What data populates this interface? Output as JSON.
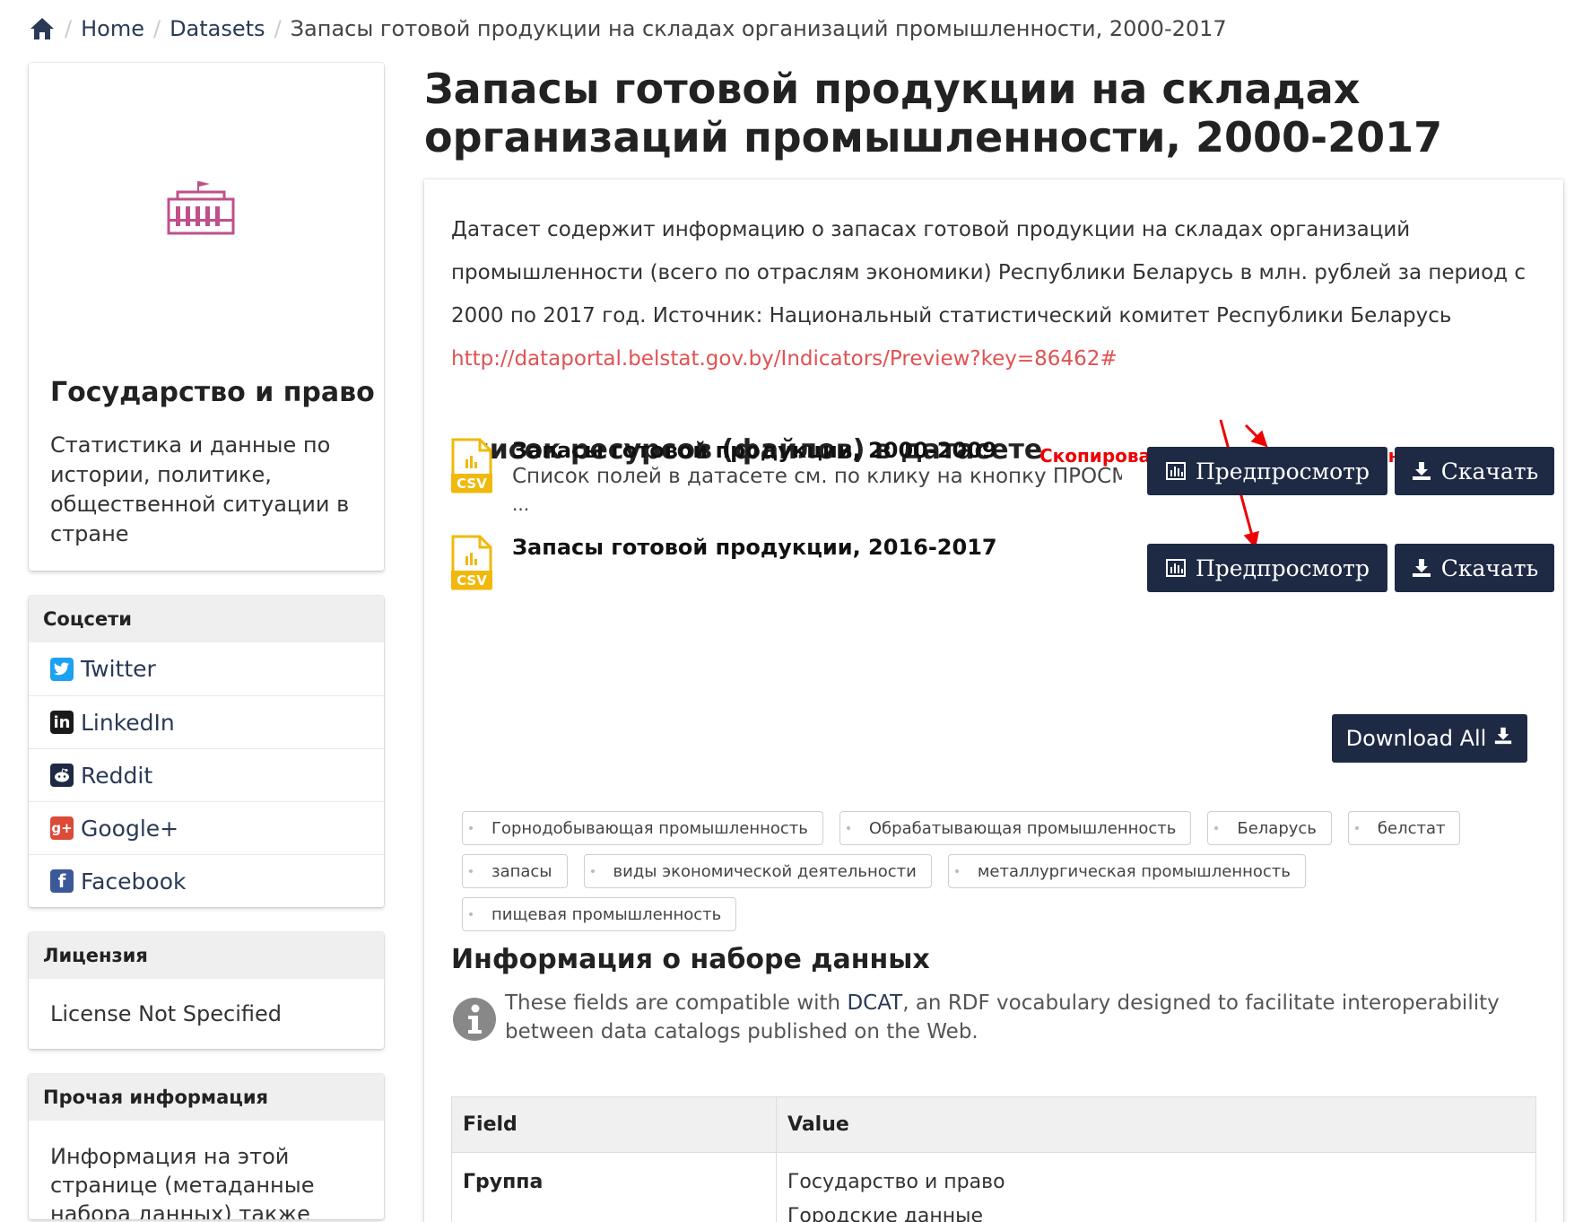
{
  "breadcrumb": {
    "home_icon": "home-icon",
    "items": [
      "Home",
      "Datasets",
      "Запасы готовой продукции на складах организаций промышленности, 2000-2017"
    ]
  },
  "organization": {
    "logo_icon": "government-building-icon",
    "title": "Государство и право",
    "description": "Статистика и данные по истории, политике, общественной ситуации в стране"
  },
  "social": {
    "heading": "Соцсети",
    "items": [
      {
        "label": "Twitter",
        "icon": "twitter-icon"
      },
      {
        "label": "LinkedIn",
        "icon": "linkedin-icon"
      },
      {
        "label": "Reddit",
        "icon": "reddit-icon"
      },
      {
        "label": "Google+",
        "icon": "google-plus-icon"
      },
      {
        "label": "Facebook",
        "icon": "facebook-icon"
      }
    ]
  },
  "license": {
    "heading": "Лицензия",
    "value": "License Not Specified"
  },
  "other_info": {
    "heading": "Прочая информация",
    "text": "Информация на этой странице (метаданные набора данных) также"
  },
  "dataset": {
    "title": "Запасы готовой продукции на складах организаций промышленности, 2000-2017",
    "notes": "Датасет содержит информацию о запасах готовой продукции на складах организаций промышленности (всего по отраслям экономики) Республики Беларусь в млн. рублей за период с 2000 по 2017 год. Источник: Национальный статистический комитет Республики Беларусь",
    "source_link": "http://dataportal.belstat.gov.by/Indicators/Preview?key=86462#"
  },
  "resources": {
    "heading": "Список ресурсов (файлов) в датасете",
    "annotation": "Скопировать ссылку для скачивания файла",
    "preview_label": "Предпросмотр",
    "download_label": "Скачать",
    "download_all_label": "Download All",
    "items": [
      {
        "name": "Запасы готовой продукции, 2000-2009",
        "description": "Список полей в датасете см. по клику на кнопку ПРОСМОТР",
        "more": "...",
        "format": "CSV"
      },
      {
        "name": "Запасы готовой продукции, 2016-2017",
        "description": "",
        "more": "",
        "format": "CSV"
      }
    ]
  },
  "tags": [
    "Горнодобывающая промышленность",
    "Обрабатывающая промышленность",
    "Беларусь",
    "белстат",
    "запасы",
    "виды экономической деятельности",
    "металлургическая промышленность",
    "пищевая промышленность"
  ],
  "dataset_info": {
    "heading": "Информация о наборе данных",
    "dcat_before": "These fields are compatible with ",
    "dcat_link": "DCAT",
    "dcat_after": ", an RDF vocabulary designed to facilitate interoperability between data catalogs published on the Web.",
    "columns": [
      "Field",
      "Value"
    ],
    "rows": [
      {
        "field": "Группа",
        "values": [
          "Государство и право",
          "Городские данные"
        ]
      }
    ]
  },
  "colors": {
    "button_bg": "#1e2a44",
    "link": "#e05252",
    "annotation": "#ee0000",
    "csv_icon": "#f0b90b",
    "org_logo": "#c0508a"
  }
}
